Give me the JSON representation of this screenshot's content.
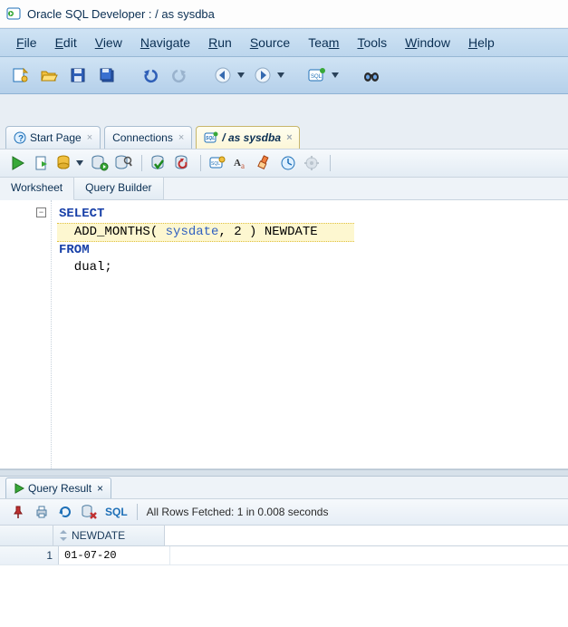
{
  "titlebar": {
    "app_title": "Oracle SQL Developer : / as sysdba"
  },
  "menu": {
    "file": "File",
    "edit": "Edit",
    "view": "View",
    "navigate": "Navigate",
    "run": "Run",
    "source": "Source",
    "team": "Team",
    "tools": "Tools",
    "window": "Window",
    "help": "Help"
  },
  "tabs": {
    "start_page": "Start Page",
    "connections": "Connections",
    "active": "/ as sysdba"
  },
  "sub_tabs": {
    "worksheet": "Worksheet",
    "query_builder": "Query Builder"
  },
  "sql": {
    "tokens": [
      {
        "t": "kw",
        "v": "SELECT"
      },
      {
        "t": "nl"
      },
      {
        "t": "hl_open"
      },
      {
        "t": "sp",
        "v": "  "
      },
      {
        "t": "fn",
        "v": "ADD_MONTHS"
      },
      {
        "t": "txt",
        "v": "( "
      },
      {
        "t": "id",
        "v": "sysdate"
      },
      {
        "t": "txt",
        "v": ", "
      },
      {
        "t": "num",
        "v": "2"
      },
      {
        "t": "txt",
        "v": " ) "
      },
      {
        "t": "col",
        "v": "NEWDATE"
      },
      {
        "t": "hl_close"
      },
      {
        "t": "nl"
      },
      {
        "t": "kw",
        "v": "FROM"
      },
      {
        "t": "nl"
      },
      {
        "t": "sp",
        "v": "  "
      },
      {
        "t": "txt",
        "v": "dual;"
      }
    ]
  },
  "results": {
    "tab_label": "Query Result",
    "sql_label": "SQL",
    "status": "All Rows Fetched: 1 in 0.008 seconds",
    "columns": [
      "NEWDATE"
    ],
    "rows": [
      {
        "n": "1",
        "cells": [
          "01-07-20"
        ]
      }
    ]
  }
}
